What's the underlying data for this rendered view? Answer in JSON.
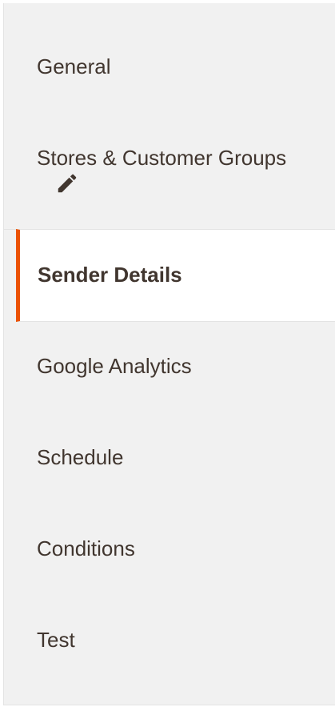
{
  "tabs": [
    {
      "label": "General"
    },
    {
      "label": "Stores & Customer Groups",
      "icon": "pencil-icon"
    },
    {
      "label": "Sender Details",
      "active": true
    },
    {
      "label": "Google Analytics"
    },
    {
      "label": "Schedule"
    },
    {
      "label": "Conditions"
    },
    {
      "label": "Test"
    }
  ],
  "colors": {
    "active_accent": "#eb5202",
    "nav_background": "#f1f1f1",
    "text": "#41362f"
  }
}
